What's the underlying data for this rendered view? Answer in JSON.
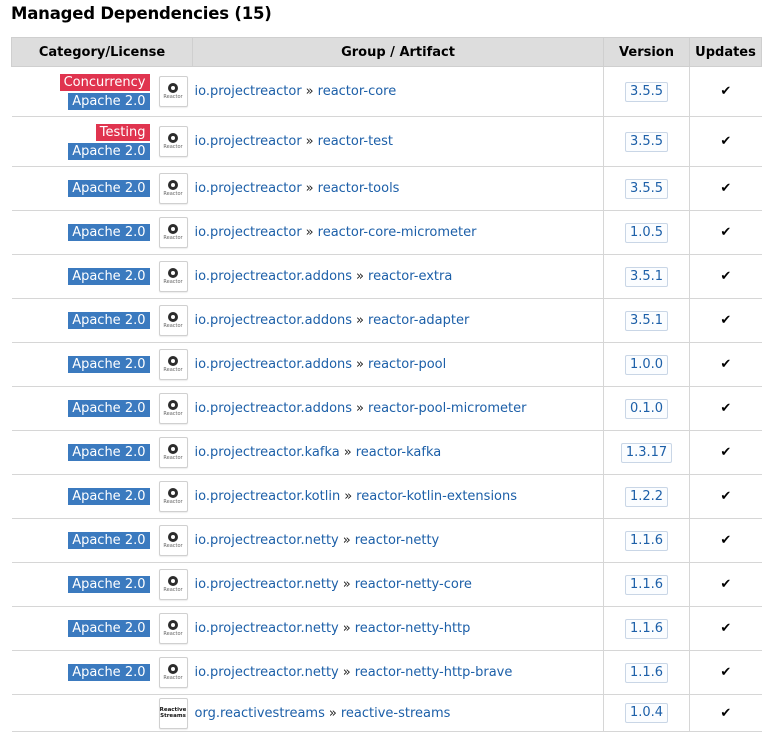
{
  "title": "Managed Dependencies (15)",
  "columns": {
    "category": "Category/License",
    "artifact": "Group / Artifact",
    "version": "Version",
    "updates": "Updates"
  },
  "separator": "»",
  "check_mark": "✔",
  "logos": {
    "reactor": "Reactor",
    "reactive_streams": "Reactive Streams"
  },
  "rows": [
    {
      "category": "Concurrency",
      "license": "Apache 2.0",
      "logo": "reactor",
      "group": "io.projectreactor",
      "artifact": "reactor-core",
      "version": "3.5.5"
    },
    {
      "category": "Testing",
      "license": "Apache 2.0",
      "logo": "reactor",
      "group": "io.projectreactor",
      "artifact": "reactor-test",
      "version": "3.5.5"
    },
    {
      "category": "",
      "license": "Apache 2.0",
      "logo": "reactor",
      "group": "io.projectreactor",
      "artifact": "reactor-tools",
      "version": "3.5.5"
    },
    {
      "category": "",
      "license": "Apache 2.0",
      "logo": "reactor",
      "group": "io.projectreactor",
      "artifact": "reactor-core-micrometer",
      "version": "1.0.5"
    },
    {
      "category": "",
      "license": "Apache 2.0",
      "logo": "reactor",
      "group": "io.projectreactor.addons",
      "artifact": "reactor-extra",
      "version": "3.5.1"
    },
    {
      "category": "",
      "license": "Apache 2.0",
      "logo": "reactor",
      "group": "io.projectreactor.addons",
      "artifact": "reactor-adapter",
      "version": "3.5.1"
    },
    {
      "category": "",
      "license": "Apache 2.0",
      "logo": "reactor",
      "group": "io.projectreactor.addons",
      "artifact": "reactor-pool",
      "version": "1.0.0"
    },
    {
      "category": "",
      "license": "Apache 2.0",
      "logo": "reactor",
      "group": "io.projectreactor.addons",
      "artifact": "reactor-pool-micrometer",
      "version": "0.1.0"
    },
    {
      "category": "",
      "license": "Apache 2.0",
      "logo": "reactor",
      "group": "io.projectreactor.kafka",
      "artifact": "reactor-kafka",
      "version": "1.3.17"
    },
    {
      "category": "",
      "license": "Apache 2.0",
      "logo": "reactor",
      "group": "io.projectreactor.kotlin",
      "artifact": "reactor-kotlin-extensions",
      "version": "1.2.2"
    },
    {
      "category": "",
      "license": "Apache 2.0",
      "logo": "reactor",
      "group": "io.projectreactor.netty",
      "artifact": "reactor-netty",
      "version": "1.1.6"
    },
    {
      "category": "",
      "license": "Apache 2.0",
      "logo": "reactor",
      "group": "io.projectreactor.netty",
      "artifact": "reactor-netty-core",
      "version": "1.1.6"
    },
    {
      "category": "",
      "license": "Apache 2.0",
      "logo": "reactor",
      "group": "io.projectreactor.netty",
      "artifact": "reactor-netty-http",
      "version": "1.1.6"
    },
    {
      "category": "",
      "license": "Apache 2.0",
      "logo": "reactor",
      "group": "io.projectreactor.netty",
      "artifact": "reactor-netty-http-brave",
      "version": "1.1.6"
    },
    {
      "category": "",
      "license": "",
      "logo": "reactive_streams",
      "group": "org.reactivestreams",
      "artifact": "reactive-streams",
      "version": "1.0.4"
    }
  ]
}
